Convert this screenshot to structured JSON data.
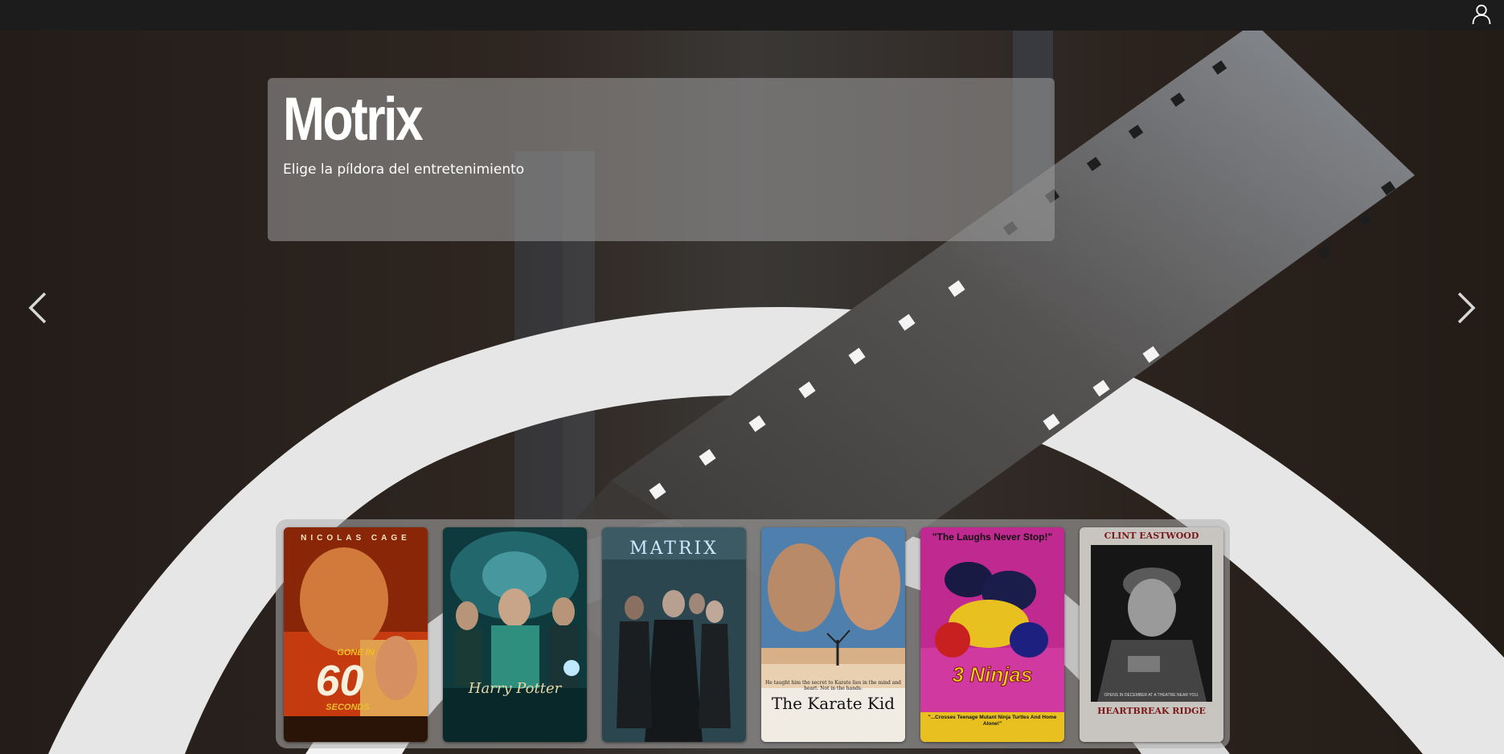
{
  "topbar": {
    "user_icon": "user-icon"
  },
  "hero": {
    "brand": "Motrix",
    "tagline": "Elige la píldora del entretenimiento",
    "prev_icon": "chevron-left-icon",
    "next_icon": "chevron-right-icon"
  },
  "posters": [
    {
      "top": "NICOLAS CAGE",
      "main": "GONE IN",
      "big": "60",
      "sub": "SECONDS",
      "bottom": ""
    },
    {
      "top": "",
      "main": "Harry Potter",
      "big": "",
      "sub": "",
      "bottom": ""
    },
    {
      "top": "MATRIX",
      "main": "",
      "big": "",
      "sub": "",
      "bottom": ""
    },
    {
      "top": "",
      "main": "The Karate Kid",
      "big": "",
      "sub": "He taught him the secret to Karate lies in the mind and heart. Not in the hands.",
      "bottom": ""
    },
    {
      "top": "\"The Laughs Never Stop!\"",
      "main": "3 Ninjas",
      "big": "",
      "sub": "\"...Crosses Teenage Mutant Ninja Turtles And Home Alone!\"",
      "bottom": ""
    },
    {
      "top": "CLINT EASTWOOD",
      "main": "HEARTBREAK RIDGE",
      "big": "",
      "sub": "OPENS IN DECEMBER AT A THEATRE NEAR YOU.",
      "bottom": ""
    }
  ],
  "colors": {
    "topbar": "#1c1c1c",
    "caption_bg": "rgba(160,160,160,0.55)",
    "text": "#ffffff"
  }
}
